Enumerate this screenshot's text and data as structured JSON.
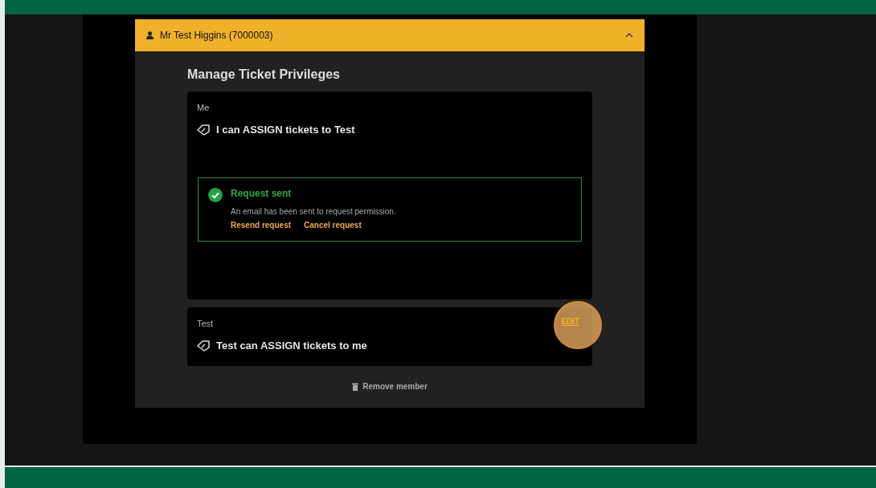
{
  "member": {
    "name": "Mr Test Higgins (7000003)",
    "expanded": true
  },
  "title": "Manage Ticket Privileges",
  "privileges": [
    {
      "party": "Me",
      "text": "I can ASSIGN tickets to Test",
      "alert": {
        "title": "Request sent",
        "message": "An email has been sent to request permission.",
        "actions": [
          "Resend request",
          "Cancel request"
        ]
      }
    },
    {
      "party": "Test",
      "text": "Test can ASSIGN tickets to me",
      "action": "EDIT",
      "highlighted": true
    }
  ],
  "remove": "Remove member"
}
